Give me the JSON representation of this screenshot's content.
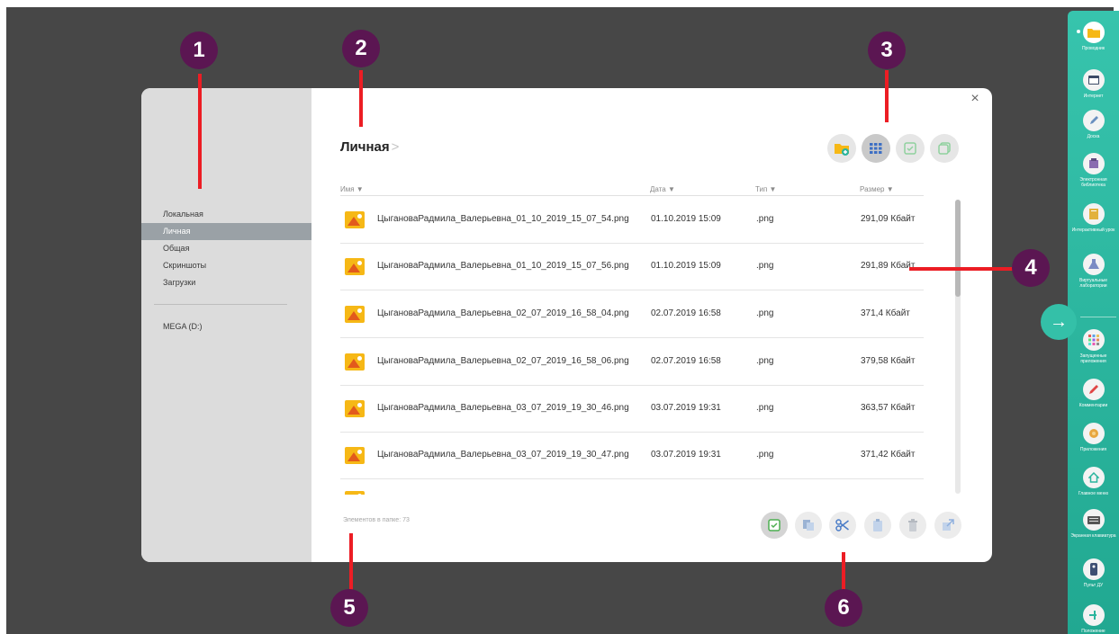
{
  "sidebar": {
    "items": [
      {
        "label": "Локальная"
      },
      {
        "label": "Личная"
      },
      {
        "label": "Общая"
      },
      {
        "label": "Скриншоты"
      },
      {
        "label": "Загрузки"
      }
    ],
    "drive_label": "MEGA (D:)"
  },
  "header": {
    "title": "Личная",
    "arrow": ">",
    "close": "×"
  },
  "columns": {
    "name": "Имя ▼",
    "date": "Дата ▼",
    "type": "Тип ▼",
    "size": "Размер ▼"
  },
  "rows": [
    {
      "name": "ЦыгановаРадмила_Валерьевна_01_10_2019_15_07_54.png",
      "date": "01.10.2019 15:09",
      "type": ".png",
      "size": "291,09 Кбайт"
    },
    {
      "name": "ЦыгановаРадмила_Валерьевна_01_10_2019_15_07_56.png",
      "date": "01.10.2019 15:09",
      "type": ".png",
      "size": "291,89 Кбайт"
    },
    {
      "name": "ЦыгановаРадмила_Валерьевна_02_07_2019_16_58_04.png",
      "date": "02.07.2019 16:58",
      "type": ".png",
      "size": "371,4 Кбайт"
    },
    {
      "name": "ЦыгановаРадмила_Валерьевна_02_07_2019_16_58_06.png",
      "date": "02.07.2019 16:58",
      "type": ".png",
      "size": "379,58 Кбайт"
    },
    {
      "name": "ЦыгановаРадмила_Валерьевна_03_07_2019_19_30_46.png",
      "date": "03.07.2019 19:31",
      "type": ".png",
      "size": "363,57 Кбайт"
    },
    {
      "name": "ЦыгановаРадмила_Валерьевна_03_07_2019_19_30_47.png",
      "date": "03.07.2019 19:31",
      "type": ".png",
      "size": "371,42 Кбайт"
    }
  ],
  "footer": {
    "count": "Элементов в папке: 73"
  },
  "markers": [
    "1",
    "2",
    "3",
    "4",
    "5",
    "6"
  ],
  "right_panel": {
    "items": [
      {
        "label": "Проводник",
        "icon": "folder-icon"
      },
      {
        "label": "Интернет",
        "icon": "browser-icon"
      },
      {
        "label": "Доска",
        "icon": "pen-icon"
      },
      {
        "label": "Электронная библиотека",
        "icon": "library-icon"
      },
      {
        "label": "Интерактивный урок",
        "icon": "lesson-icon"
      },
      {
        "label": "Виртуальные лаборатории",
        "icon": "lab-icon"
      },
      {
        "label": "Запущенные приложения",
        "icon": "apps-grid-icon"
      },
      {
        "label": "Комментарии",
        "icon": "marker-icon"
      },
      {
        "label": "Приложения",
        "icon": "box-icon"
      },
      {
        "label": "Главное меню",
        "icon": "home-icon"
      },
      {
        "label": "Экранная клавиатура",
        "icon": "keyboard-icon"
      },
      {
        "label": "Пульт ДУ",
        "icon": "remote-icon"
      },
      {
        "label": "Положение",
        "icon": "position-icon"
      }
    ],
    "expand": "→"
  },
  "colors": {
    "marker": "#5b1652",
    "annotation_line": "#ec1d24",
    "panel_teal": "#2bb59e",
    "file_icon": "#f6b816",
    "selected_sidebar": "#9aa1a6"
  }
}
